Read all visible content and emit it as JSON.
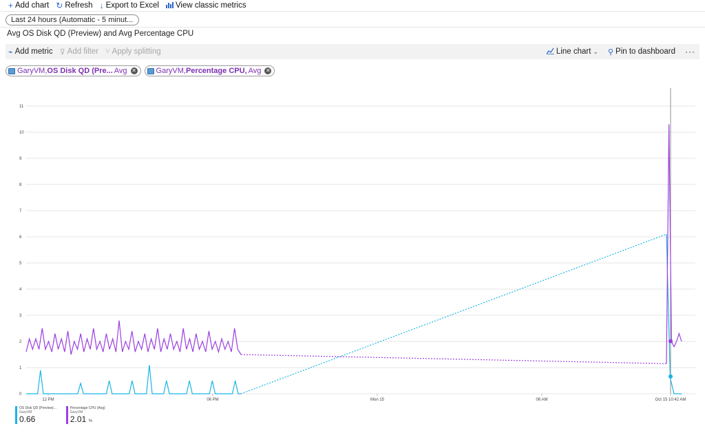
{
  "toolbar": {
    "add_chart": "Add chart",
    "refresh": "Refresh",
    "export": "Export to Excel",
    "classic": "View classic metrics"
  },
  "time_range": "Last 24 hours (Automatic - 5 minut...",
  "chart_title": "Avg OS Disk QD (Preview) and Avg Percentage CPU",
  "command_bar": {
    "add_metric": "Add metric",
    "add_filter": "Add filter",
    "apply_splitting": "Apply splitting",
    "chart_type": "Line chart",
    "pin": "Pin to dashboard",
    "more": "···"
  },
  "metric_pills": [
    {
      "resource": "GaryVM,",
      "metric": "OS Disk QD (Pre...",
      "aggregation": "Avg"
    },
    {
      "resource": "GaryVM,",
      "metric": "Percentage CPU,",
      "aggregation": "Avg"
    }
  ],
  "colors": {
    "disk": "#1ab3e6",
    "cpu": "#9b3fe0",
    "accent": "#2a66c8"
  },
  "chart_data": {
    "type": "line",
    "x_tick_labels": [
      "12 PM",
      "06 PM",
      "Mon 15",
      "06 AM",
      "Oct 15 10:42 AM"
    ],
    "y_tick_labels": [
      "0",
      "1",
      "2",
      "3",
      "4",
      "5",
      "6",
      "7",
      "8",
      "9",
      "10",
      "11"
    ],
    "ylim": [
      0,
      11.5
    ],
    "series": [
      {
        "name": "OS Disk QD (Preview)...",
        "values_segment1": [
          0,
          0,
          0,
          0,
          0,
          0.9,
          0,
          0,
          0,
          0,
          0,
          0,
          0,
          0,
          0,
          0,
          0,
          0,
          0,
          0.4,
          0,
          0,
          0,
          0,
          0,
          0,
          0,
          0,
          0,
          0.5,
          0,
          0,
          0,
          0,
          0,
          0,
          0,
          0.5,
          0,
          0,
          0,
          0,
          0,
          1.1,
          0,
          0,
          0,
          0,
          0,
          0.5,
          0,
          0,
          0,
          0,
          0,
          0,
          0,
          0.5,
          0,
          0,
          0,
          0,
          0,
          0,
          0,
          0.5,
          0,
          0,
          0,
          0,
          0,
          0,
          0,
          0.5,
          0,
          0
        ],
        "gap_end_value": 6.1,
        "values_segment2": [
          6.1,
          0.6,
          0,
          0,
          0
        ],
        "current_value": "0.66"
      },
      {
        "name": "Percentage CPU (Avg)",
        "values_segment1": [
          1.6,
          2.1,
          1.7,
          2.1,
          1.7,
          2.5,
          1.7,
          2.0,
          1.6,
          2.3,
          1.7,
          2.1,
          1.6,
          2.4,
          1.5,
          2.0,
          1.7,
          2.3,
          1.6,
          2.1,
          1.7,
          2.5,
          1.7,
          2.0,
          1.6,
          2.3,
          1.7,
          2.1,
          1.6,
          2.8,
          1.6,
          2.0,
          1.7,
          2.4,
          1.6,
          2.0,
          1.7,
          2.3,
          1.6,
          2.1,
          1.7,
          2.5,
          1.6,
          2.1,
          1.7,
          2.3,
          1.7,
          2.0,
          1.6,
          2.5,
          1.7,
          2.1,
          1.6,
          2.3,
          1.7,
          2.0,
          1.6,
          2.4,
          1.7,
          2.0,
          1.6,
          2.1,
          1.7,
          2.0,
          1.6,
          2.5,
          1.7,
          1.5
        ],
        "gap_end_value": 1.15,
        "values_segment2": [
          1.15,
          10.3,
          2.0,
          1.8,
          2.0,
          2.3,
          2.0
        ],
        "current_value": "2.01",
        "unit": "%"
      }
    ]
  },
  "legend": [
    {
      "name": "OS Disk QD (Preview)...",
      "resource": "GaryVM",
      "value": "0.66",
      "unit": ""
    },
    {
      "name": "Percentage CPU (Avg)",
      "resource": "GaryVM",
      "value": "2.01",
      "unit": "%"
    }
  ]
}
